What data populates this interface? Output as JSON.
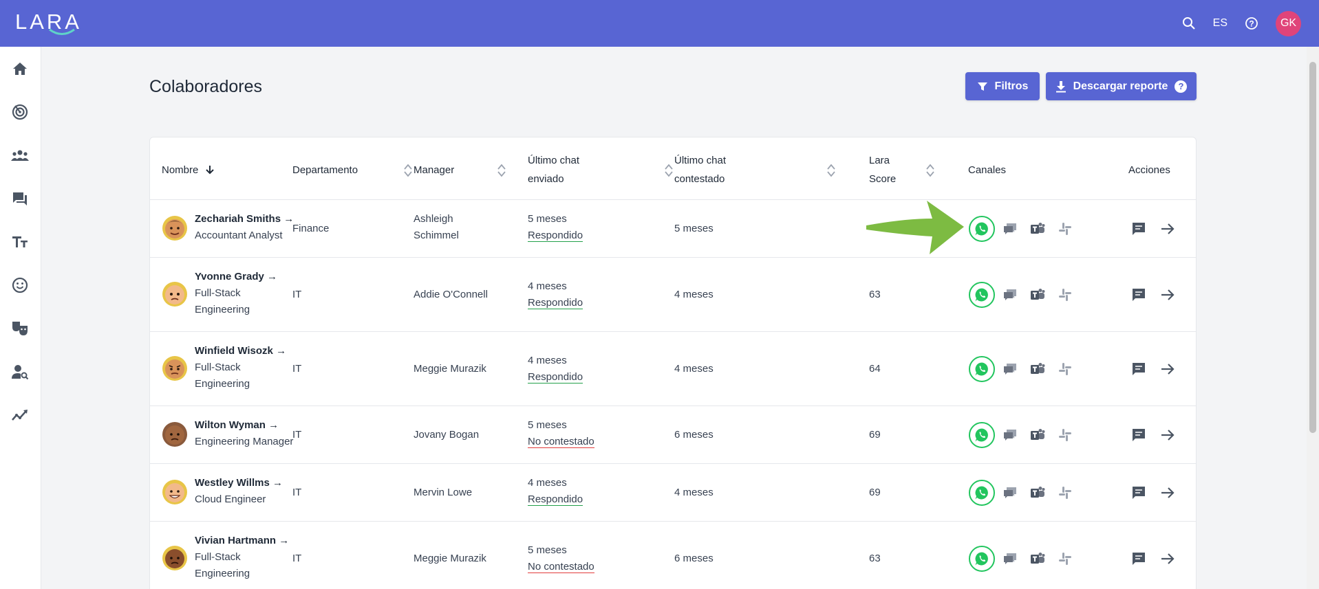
{
  "app": {
    "logo": "LARA",
    "lang": "ES",
    "user_initials": "GK"
  },
  "page": {
    "title": "Colaboradores"
  },
  "buttons": {
    "filters": "Filtros",
    "download": "Descargar reporte",
    "help": "?"
  },
  "table": {
    "headers": {
      "name": "Nombre",
      "department": "Departamento",
      "manager": "Manager",
      "last_sent_1": "Último chat",
      "last_sent_2": "enviado",
      "last_answered_1": "Último chat",
      "last_answered_2": "contestado",
      "score_1": "Lara",
      "score_2": "Score",
      "channels": "Canales",
      "actions": "Acciones"
    },
    "rows": [
      {
        "name": "Zechariah Smiths",
        "role1": "Accountant Analyst",
        "role2": "",
        "department": "Finance",
        "manager1": "Ashleigh",
        "manager2": "Schimmel",
        "sent": "5 meses",
        "status": "Respondido",
        "answered": "5 meses",
        "score": ""
      },
      {
        "name": "Yvonne Grady",
        "role1": "Full-Stack",
        "role2": "Engineering",
        "department": "IT",
        "manager1": "Addie O'Connell",
        "manager2": "",
        "sent": "4 meses",
        "status": "Respondido",
        "answered": "4 meses",
        "score": "63"
      },
      {
        "name": "Winfield Wisozk",
        "role1": "Full-Stack",
        "role2": "Engineering",
        "department": "IT",
        "manager1": "Meggie Murazik",
        "manager2": "",
        "sent": "4 meses",
        "status": "Respondido",
        "answered": "4 meses",
        "score": "64"
      },
      {
        "name": "Wilton Wyman",
        "role1": "Engineering Manager",
        "role2": "",
        "department": "IT",
        "manager1": "Jovany Bogan",
        "manager2": "",
        "sent": "5 meses",
        "status": "No contestado",
        "answered": "6 meses",
        "score": "69"
      },
      {
        "name": "Westley Willms",
        "role1": "Cloud Engineer",
        "role2": "",
        "department": "IT",
        "manager1": "Mervin Lowe",
        "manager2": "",
        "sent": "4 meses",
        "status": "Respondido",
        "answered": "4 meses",
        "score": "69"
      },
      {
        "name": "Vivian Hartmann",
        "role1": "Full-Stack",
        "role2": "Engineering",
        "department": "IT",
        "manager1": "Meggie Murazik",
        "manager2": "",
        "sent": "5 meses",
        "status": "No contestado",
        "answered": "6 meses",
        "score": "63"
      }
    ]
  },
  "colors": {
    "brand": "#5865d3",
    "ok": "#22a049",
    "no": "#e23b3b",
    "whatsapp": "#22c55e",
    "annotation_arrow": "#7dbb42"
  }
}
